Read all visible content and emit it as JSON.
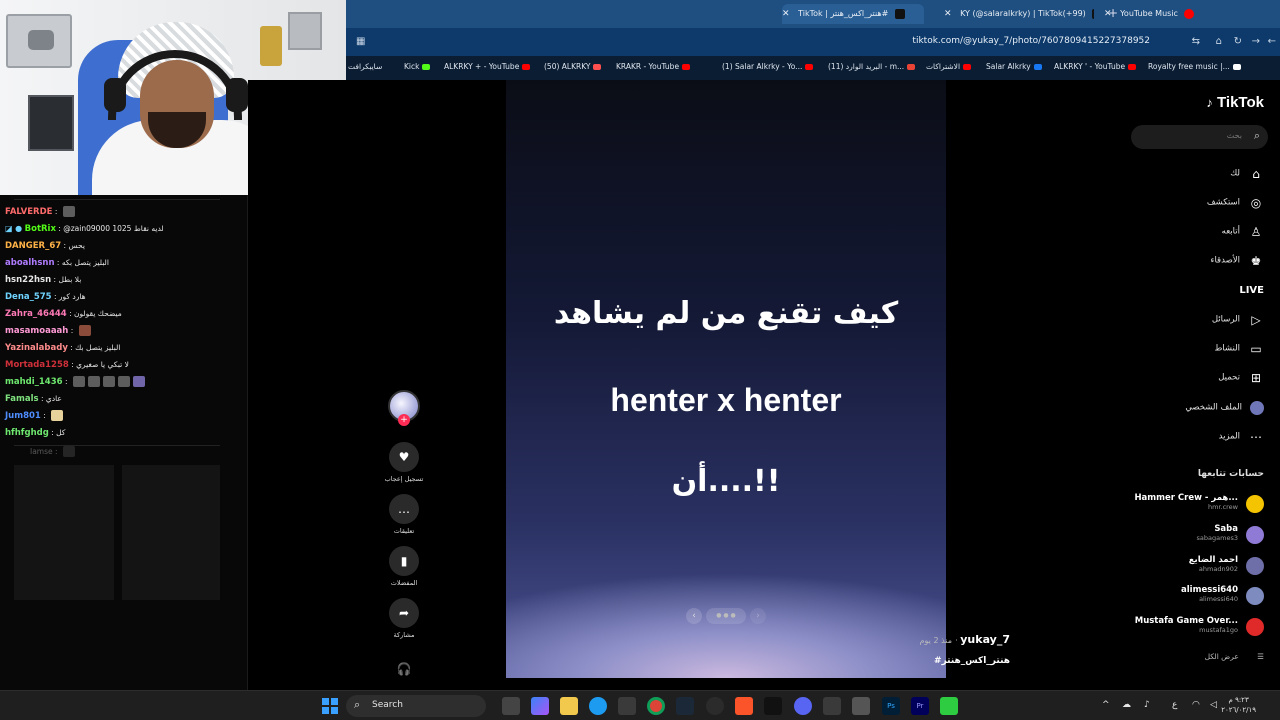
{
  "browser": {
    "tabs": [
      {
        "title": "TikTok | هنتر_اكس_هنتر#",
        "color": "#111111"
      },
      {
        "title": "KY (@salaralkrky) | TikTok(+99)",
        "color": "#111111"
      },
      {
        "title": "YouTube Music",
        "color": "#ff0000"
      }
    ],
    "new_tab": "+",
    "url": "tiktok.com/@yukay_7/photo/7607809415227378952",
    "bookmarks": [
      {
        "label": "سايبكرافت",
        "color": "#3b5ba8"
      },
      {
        "label": "Kick",
        "color": "#53fc18"
      },
      {
        "label": "ALKRKY + - YouTube",
        "color": "#ff0000"
      },
      {
        "label": "(50) ALKRKY",
        "color": "#ff4f4f"
      },
      {
        "label": "KRAKR - YouTube",
        "color": "#ff0000"
      },
      {
        "label": "(1) Salar Alkrky - Yo...",
        "color": "#ff0000"
      },
      {
        "label": "(11) البريد الوارد - m...",
        "color": "#ea4335"
      },
      {
        "label": "الاشتراكات",
        "color": "#ff0000"
      },
      {
        "label": "Salar Alkrky",
        "color": "#1877f2"
      },
      {
        "label": "ALKRKY ' - YouTube",
        "color": "#ff0000"
      },
      {
        "label": "Royalty free music |...",
        "color": "#ffffff"
      }
    ]
  },
  "chat": {
    "lines": [
      {
        "user": "FALVERDE",
        "color": "#ff6b6b",
        "msg": "",
        "emotes": 1
      },
      {
        "user": "BotRix",
        "color": "#53fc18",
        "msg": "@zain09000 1025 لديه نقاط",
        "emotes": 0
      },
      {
        "user": "DANGER_67",
        "color": "#ffb347",
        "msg": "يحس",
        "emotes": 0
      },
      {
        "user": "aboalhsnn",
        "color": "#b07cff",
        "msg": "البليز يتصل بكه",
        "emotes": 0
      },
      {
        "user": "hsn22hsn",
        "color": "#e6e6e6",
        "msg": "بلا بطل",
        "emotes": 0
      },
      {
        "user": "Dena_575",
        "color": "#6fd3ff",
        "msg": "هارد كور",
        "emotes": 0
      },
      {
        "user": "Zahra_46444",
        "color": "#ff7ab6",
        "msg": "ميضحك يقولون",
        "emotes": 0
      },
      {
        "user": "masamoaaah",
        "color": "#ff9ad5",
        "msg": "",
        "emotes": 1
      },
      {
        "user": "Yazinalabady",
        "color": "#ff8c8c",
        "msg": "البليز يتصل بك",
        "emotes": 0
      },
      {
        "user": "Mortada1258",
        "color": "#d0303a",
        "msg": "لا تبكي يا صغيري",
        "emotes": 0
      },
      {
        "user": "mahdi_1436",
        "color": "#6ee86e",
        "msg": "",
        "emotes": 4
      },
      {
        "user": "Famals",
        "color": "#7fe27f",
        "msg": "عادي",
        "emotes": 0
      },
      {
        "user": "Jum801",
        "color": "#4f8dff",
        "msg": "",
        "emotes": 1
      },
      {
        "user": "hfhfghdg",
        "color": "#6ee86e",
        "msg": "كل",
        "emotes": 0
      }
    ]
  },
  "slide": {
    "line1": "كيف تقنع من لم يشاهد",
    "line2": "henter x henter",
    "line3": "أن....!!"
  },
  "actions": [
    {
      "icon": "♥",
      "label": "تسجيل إعجاب"
    },
    {
      "icon": "…",
      "label": "تعليقات"
    },
    {
      "icon": "▮",
      "label": "المفضلات"
    },
    {
      "icon": "➦",
      "label": "مشاركة"
    }
  ],
  "post": {
    "author": "yukay_7",
    "time": "منذ 2 يوم",
    "caption": "#هنتر_اكس_هنتر"
  },
  "sidebar": {
    "logo": "TikTok",
    "search_placeholder": "بحث",
    "nav": [
      {
        "label": "لك",
        "icon": "⌂"
      },
      {
        "label": "استكشف",
        "icon": "◎"
      },
      {
        "label": "أتابعه",
        "icon": "♙"
      },
      {
        "label": "الأصدقاء",
        "icon": "♚"
      },
      {
        "label": "LIVE",
        "icon": ""
      },
      {
        "label": "الرسائل",
        "icon": "▷"
      },
      {
        "label": "النشاط",
        "icon": "▭"
      },
      {
        "label": "تحميل",
        "icon": "⊞"
      },
      {
        "label": "الملف الشخصي",
        "icon": ""
      },
      {
        "label": "المزيد",
        "icon": "⋯"
      }
    ],
    "following_title": "حسابات تتابعها",
    "accounts": [
      {
        "name": "Hammer Crew - همر...",
        "handle": "hmr.crew",
        "color": "#f5c400"
      },
      {
        "name": "Saba",
        "handle": "sabagames3",
        "color": "#8f7bd6"
      },
      {
        "name": "احمد الضايع",
        "handle": "ahmadn902",
        "color": "#6e6ea8"
      },
      {
        "name": "alimessi640",
        "handle": "alimessi640",
        "color": "#7d8bbf"
      },
      {
        "name": "Mustafa Game Over...",
        "handle": "mustafa1go",
        "color": "#e02a2a"
      }
    ],
    "see_all": "عرض الكل"
  },
  "taskbar": {
    "search": "Search",
    "time": "٩:٢٣ م",
    "date": "٢٠٢٦/٠٢/١٩",
    "lang": "ع"
  }
}
